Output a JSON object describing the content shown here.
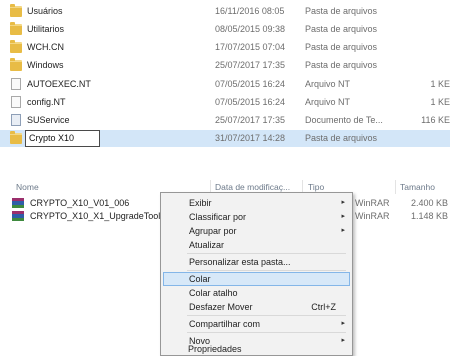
{
  "top_files": [
    {
      "name": "Usuários",
      "date": "16/11/2016 08:05",
      "type": "Pasta de arquivos",
      "size": "",
      "icon": "folder-icon"
    },
    {
      "name": "Utilitarios",
      "date": "08/05/2015 09:38",
      "type": "Pasta de arquivos",
      "size": "",
      "icon": "folder-icon"
    },
    {
      "name": "WCH.CN",
      "date": "17/07/2015 07:04",
      "type": "Pasta de arquivos",
      "size": "",
      "icon": "folder-icon"
    },
    {
      "name": "Windows",
      "date": "25/07/2017 17:35",
      "type": "Pasta de arquivos",
      "size": "",
      "icon": "folder-icon"
    },
    {
      "name": "AUTOEXEC.NT",
      "date": "07/05/2015 16:24",
      "type": "Arquivo NT",
      "size": "1 KE",
      "icon": "file-icon"
    },
    {
      "name": "config.NT",
      "date": "07/05/2015 16:24",
      "type": "Arquivo NT",
      "size": "1 KE",
      "icon": "file-icon"
    },
    {
      "name": "SUService",
      "date": "25/07/2017 17:35",
      "type": "Documento de Te...",
      "size": "116 KE",
      "icon": "file-icon"
    },
    {
      "name": "Crypto X10",
      "date": "31/07/2017 14:28",
      "type": "Pasta de arquivos",
      "size": "",
      "icon": "folder-icon",
      "renaming": true
    }
  ],
  "bottom_headers": {
    "name": "Nome",
    "date": "Data de modificaç...",
    "type": "Tipo",
    "size": "Tamanho"
  },
  "bottom_files": [
    {
      "name": "CRYPTO_X10_V01_006",
      "type": "WinRAR",
      "size": "2.400 KB",
      "icon": "winrar-icon"
    },
    {
      "name": "CRYPTO_X10_X1_UpgradeTool",
      "type": "WinRAR",
      "size": "1.148 KB",
      "icon": "winrar-icon"
    }
  ],
  "context_menu": {
    "items": [
      {
        "label": "Exibir",
        "submenu": true
      },
      {
        "label": "Classificar por",
        "submenu": true
      },
      {
        "label": "Agrupar por",
        "submenu": true
      },
      {
        "label": "Atualizar"
      },
      {
        "separator": true
      },
      {
        "label": "Personalizar esta pasta..."
      },
      {
        "separator": true
      },
      {
        "label": "Colar",
        "highlighted": true
      },
      {
        "label": "Colar atalho"
      },
      {
        "label": "Desfazer Mover",
        "shortcut": "Ctrl+Z"
      },
      {
        "separator": true
      },
      {
        "label": "Compartilhar com",
        "submenu": true
      },
      {
        "separator": true
      },
      {
        "label": "Novo",
        "submenu": true
      },
      {
        "separator": true
      },
      {
        "label": "Propriedades"
      }
    ],
    "submenu_arrow": "▸"
  },
  "colors": {
    "selection": "#d3e6f8",
    "menu_bg": "#f2f2f2",
    "menu_hover": "#d7e8f8",
    "folder": "#e8bc46"
  }
}
